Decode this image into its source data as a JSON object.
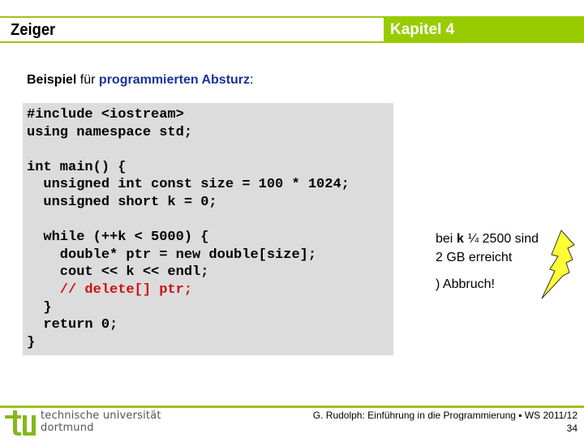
{
  "header": {
    "title": "Zeiger",
    "chapter": "Kapitel 4",
    "accent_color": "#99cc00"
  },
  "subtitle": {
    "part1": "Beispiel",
    "part2": " für ",
    "part3": "programmierten Absturz",
    "part4": ":"
  },
  "code": {
    "lines": [
      "#include <iostream>",
      "using namespace std;",
      "",
      "int main() {",
      "  unsigned int const size = 100 * 1024;",
      "  unsigned short k = 0;",
      "",
      "  while (++k < 5000) {",
      "    double* ptr = new double[size];",
      "    cout << k << endl;",
      "    // delete[] ptr;",
      "  }",
      "  return 0;",
      "}"
    ],
    "comment_line_index": 10,
    "comment_color": "#cc1111"
  },
  "note": {
    "line1_prefix": "bei ",
    "line1_var": "k",
    "line1_suffix": " ¼ 2500 sind",
    "line2": "2 GB erreicht",
    "line3": ") Abbruch!",
    "icon": "lightning-bolt-icon"
  },
  "footer": {
    "university_line1": "technische universität",
    "university_line2": "dortmund",
    "credit": "G. Rudolph: Einführung in die Programmierung ▪ WS 2011/12",
    "page_number": "34"
  }
}
